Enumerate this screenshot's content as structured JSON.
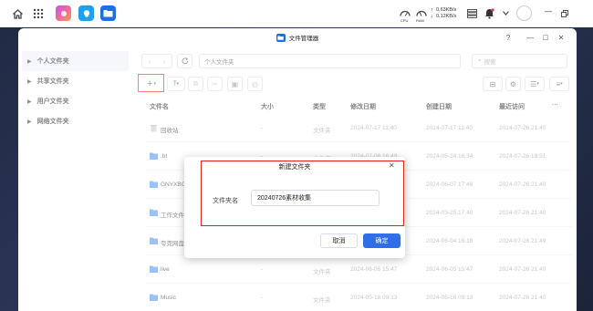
{
  "taskbar": {
    "net_up": "0.63KB/s",
    "net_down": "0.12KB/s",
    "cpu_label": "CPU",
    "ram_label": "RAM"
  },
  "window": {
    "title": "文件管理器",
    "help": "?",
    "minimize": "—",
    "maximize": "□",
    "close": "✕"
  },
  "sidebar": {
    "items": [
      {
        "label": "个人文件夹"
      },
      {
        "label": "共享文件夹"
      },
      {
        "label": "用户文件夹"
      },
      {
        "label": "网络文件夹"
      }
    ]
  },
  "toolbar": {
    "path": "个人文件夹",
    "search_placeholder": "搜索",
    "add_label": "+"
  },
  "table": {
    "headers": {
      "name": "文件名",
      "size": "大小",
      "type": "类型",
      "modified": "修改日期",
      "created": "创建日期",
      "accessed": "最近访问",
      "more": "···"
    },
    "rows": [
      {
        "name": "回收站",
        "size": "-",
        "type": "文件夹",
        "modified": "2024-07-17 11:40",
        "created": "2024-07-17 11:40",
        "accessed": "2024-07-26 21:40"
      },
      {
        "name": ".bt",
        "size": "-",
        "type": "文件夹",
        "modified": "2024-07-08 16:49",
        "created": "2024-05-24 16:34",
        "accessed": "2024-07-26 19:51"
      },
      {
        "name": "GNYXBGA",
        "size": "-",
        "type": "文件夹",
        "modified": "",
        "created": "2024-06-07 17:46",
        "accessed": "2024-07-26 21:40"
      },
      {
        "name": "工作文件",
        "size": "-",
        "type": "文件夹",
        "modified": "",
        "created": "2024-03-25 17:40",
        "accessed": "2024-07-26 21:40"
      },
      {
        "name": "夸克网盘",
        "size": "-",
        "type": "文件夹",
        "modified": "",
        "created": "2024-06-04 16:18",
        "accessed": "2024-07-26 21:49"
      },
      {
        "name": "live",
        "size": "-",
        "type": "文件夹",
        "modified": "2024-06-05 15:47",
        "created": "2024-06-05 15:47",
        "accessed": "2024-07-26 21:40"
      },
      {
        "name": "Music",
        "size": "-",
        "type": "文件夹",
        "modified": "2024-05-18 09:13",
        "created": "2024-05-18 09:13",
        "accessed": "2024-07-26 21:40"
      }
    ]
  },
  "dialog": {
    "title": "新建文件夹",
    "field_label": "文件夹名",
    "field_value": "20240726素材收集",
    "cancel": "取消",
    "confirm": "确定",
    "close": "✕"
  },
  "colors": {
    "accent": "#2f6ee8",
    "highlight": "#e02020",
    "folder": "#4a8ef0"
  }
}
